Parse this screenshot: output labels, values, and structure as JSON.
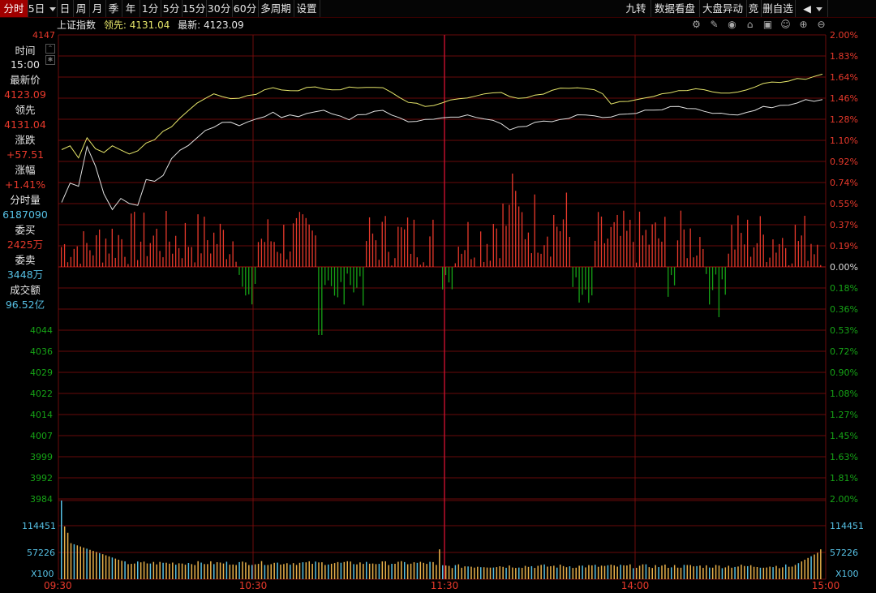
{
  "toolbar": {
    "items": [
      "分时",
      "5日",
      "日",
      "周",
      "月",
      "季",
      "年",
      "1分",
      "5分",
      "15分",
      "30分",
      "60分",
      "多周期",
      "设置"
    ],
    "right_items": [
      "九转",
      "数据看盘",
      "大盘异动",
      "竞",
      "删自选"
    ],
    "back_label": "◀"
  },
  "header": {
    "index_name": "上证指数",
    "lead_label": "领先:",
    "lead_value": "4131.04",
    "latest_label": "最新:",
    "latest_value": "4123.09"
  },
  "info_panel": {
    "time_label": "时间",
    "time_value": "15:00",
    "price_label": "最新价",
    "price_value": "4123.09",
    "lead_label": "领先",
    "lead_value": "4131.04",
    "change_label": "涨跌",
    "change_value": "+57.51",
    "pct_label": "涨幅",
    "pct_value": "+1.41%",
    "vol_label": "分时量",
    "vol_value": "6187090",
    "bid_label": "委买",
    "bid_value": "2425万",
    "ask_label": "委卖",
    "ask_value": "3448万",
    "amount_label": "成交额",
    "amount_value": "96.52亿"
  },
  "colors": {
    "up": "#e8392b",
    "down": "#16a316",
    "grid": "#8a0e0e",
    "price_line": "#e0e0e0",
    "lead_line": "#e6e66a",
    "vol_bar": "#e8b04a",
    "vol_bar_blue": "#56c0e4"
  },
  "chart_data": {
    "type": "line",
    "x_ticks": [
      "09:30",
      "10:30",
      "11:30",
      "14:00",
      "15:00"
    ],
    "left_price_ticks_top": [
      "4147"
    ],
    "left_price_ticks_bottom": [
      "4044",
      "4036",
      "4029",
      "4022",
      "4014",
      "4007",
      "3999",
      "3992",
      "3984"
    ],
    "right_pct_ticks_up": [
      "2.00%",
      "1.83%",
      "1.64%",
      "1.46%",
      "1.28%",
      "1.10%",
      "0.92%",
      "0.74%",
      "0.55%",
      "0.37%",
      "0.19%"
    ],
    "zero_label": "0.00%",
    "right_pct_ticks_down": [
      "0.18%",
      "0.36%",
      "0.53%",
      "0.72%",
      "0.90%",
      "1.08%",
      "1.27%",
      "1.45%",
      "1.63%",
      "1.81%",
      "2.00%"
    ],
    "volume_ticks_left": [
      "114451",
      "57226",
      "X100"
    ],
    "volume_ticks_right": [
      "114451",
      "57226",
      "X100"
    ],
    "series": [
      {
        "name": "最新",
        "values_pct": [
          0.55,
          0.72,
          0.7,
          1.05,
          0.88,
          0.62,
          0.48,
          0.6,
          0.56,
          0.54,
          0.76,
          0.74,
          0.8,
          0.92,
          1.0,
          1.05,
          1.1,
          1.18,
          1.2,
          1.24,
          1.26,
          1.22,
          1.24,
          1.28,
          1.3,
          1.32,
          1.28,
          1.3,
          1.29,
          1.31,
          1.33,
          1.35,
          1.32,
          1.3,
          1.28,
          1.3,
          1.31,
          1.33,
          1.34,
          1.3,
          1.28,
          1.24,
          1.25,
          1.26,
          1.27,
          1.28,
          1.3,
          1.29,
          1.31,
          1.3,
          1.28,
          1.26,
          1.24,
          1.18,
          1.2,
          1.22,
          1.24,
          1.26,
          1.25,
          1.27,
          1.29,
          1.3,
          1.31,
          1.3,
          1.28,
          1.3,
          1.32,
          1.31,
          1.33,
          1.34,
          1.35,
          1.36,
          1.37,
          1.38,
          1.36,
          1.35,
          1.34,
          1.33,
          1.32,
          1.3,
          1.31,
          1.33,
          1.35,
          1.37,
          1.38,
          1.39,
          1.4,
          1.42,
          1.43,
          1.44,
          1.45
        ]
      },
      {
        "name": "领先",
        "values_pct": [
          1.0,
          1.05,
          0.95,
          1.1,
          1.02,
          0.98,
          1.04,
          1.0,
          0.98,
          1.0,
          1.06,
          1.1,
          1.18,
          1.22,
          1.28,
          1.36,
          1.42,
          1.45,
          1.48,
          1.46,
          1.44,
          1.46,
          1.48,
          1.5,
          1.52,
          1.54,
          1.52,
          1.51,
          1.53,
          1.55,
          1.56,
          1.54,
          1.52,
          1.53,
          1.54,
          1.55,
          1.56,
          1.55,
          1.54,
          1.5,
          1.46,
          1.42,
          1.4,
          1.38,
          1.4,
          1.42,
          1.44,
          1.45,
          1.46,
          1.47,
          1.48,
          1.49,
          1.5,
          1.48,
          1.46,
          1.47,
          1.48,
          1.5,
          1.52,
          1.53,
          1.55,
          1.54,
          1.53,
          1.52,
          1.48,
          1.4,
          1.42,
          1.44,
          1.45,
          1.46,
          1.47,
          1.48,
          1.5,
          1.51,
          1.52,
          1.53,
          1.52,
          1.51,
          1.5,
          1.49,
          1.51,
          1.53,
          1.55,
          1.57,
          1.58,
          1.59,
          1.6,
          1.61,
          1.62,
          1.63,
          1.65
        ]
      }
    ],
    "x_range": [
      "09:30",
      "15:00"
    ],
    "y_range_pct": [
      -2.0,
      2.0
    ]
  }
}
